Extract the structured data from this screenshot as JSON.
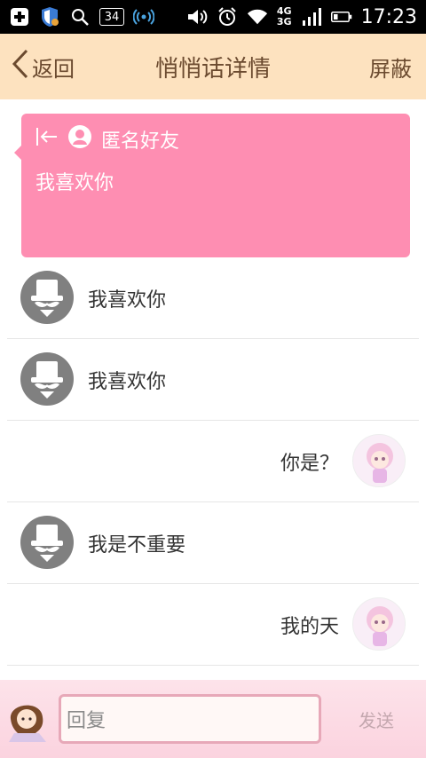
{
  "status_bar": {
    "time": "17:23",
    "notification_count": "34",
    "network": "4G 3G",
    "icons": [
      "add-icon",
      "shield-icon",
      "search-icon",
      "signal-broadcast-icon",
      "volume-icon",
      "alarm-icon",
      "wifi-icon",
      "cellular-signal-icon",
      "battery-icon"
    ]
  },
  "titlebar": {
    "back_label": "返回",
    "title": "悄悄话详情",
    "block_label": "屏蔽"
  },
  "card": {
    "sender": "匿名好友",
    "message": "我喜欢你",
    "icons": [
      "exit-arrow-icon",
      "anonymous-user-icon"
    ]
  },
  "messages": [
    {
      "side": "left",
      "text": "我喜欢你",
      "avatar": "masked-figure-avatar"
    },
    {
      "side": "left",
      "text": "我喜欢你",
      "avatar": "masked-figure-avatar"
    },
    {
      "side": "right",
      "text": "你是？",
      "avatar": "cartoon-girl-avatar"
    },
    {
      "side": "left",
      "text": "我是不重要",
      "avatar": "masked-figure-avatar"
    },
    {
      "side": "right",
      "text": "我的天",
      "avatar": "cartoon-girl-avatar"
    }
  ],
  "reply": {
    "placeholder": "回复",
    "send_label": "发送"
  },
  "colors": {
    "titlebar_bg": "#fde2bf",
    "card_bg": "#fe8eb2",
    "mask_avatar_bg": "#808080",
    "reply_bar_bg": "#fde3ea"
  }
}
